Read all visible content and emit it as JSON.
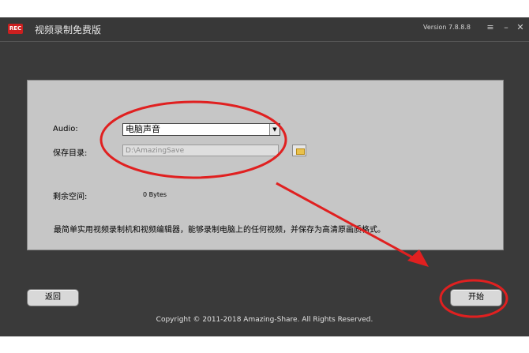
{
  "window": {
    "title": "视频录制免费版",
    "logo_text": "REC",
    "version": "Version 7.8.8.8",
    "menu_symbol": "≡",
    "minimize_symbol": "–",
    "close_symbol": "✕"
  },
  "form": {
    "audio_label": "Audio:",
    "audio_value": "电脑声音",
    "save_dir_label": "保存目录:",
    "save_dir_value": "D:\\AmazingSave",
    "free_space_label": "剩余空间:",
    "free_space_value": "0 Bytes",
    "description": "最简单实用视频录制机和视频编辑器，能够录制电脑上的任何视频，并保存为高清原画质格式。"
  },
  "buttons": {
    "back": "返回",
    "start": "开始"
  },
  "footer": {
    "copyright": "Copyright © 2011-2018 Amazing-Share. All Rights Reserved."
  },
  "colors": {
    "annotation": "#e02020",
    "app_background": "#3a3a3a",
    "panel_background": "#c6c6c6",
    "logo_red": "#cc1f1f"
  },
  "icons": [
    "rec-logo",
    "menu-icon",
    "minimize-icon",
    "close-icon",
    "dropdown-arrow-icon",
    "folder-icon"
  ]
}
